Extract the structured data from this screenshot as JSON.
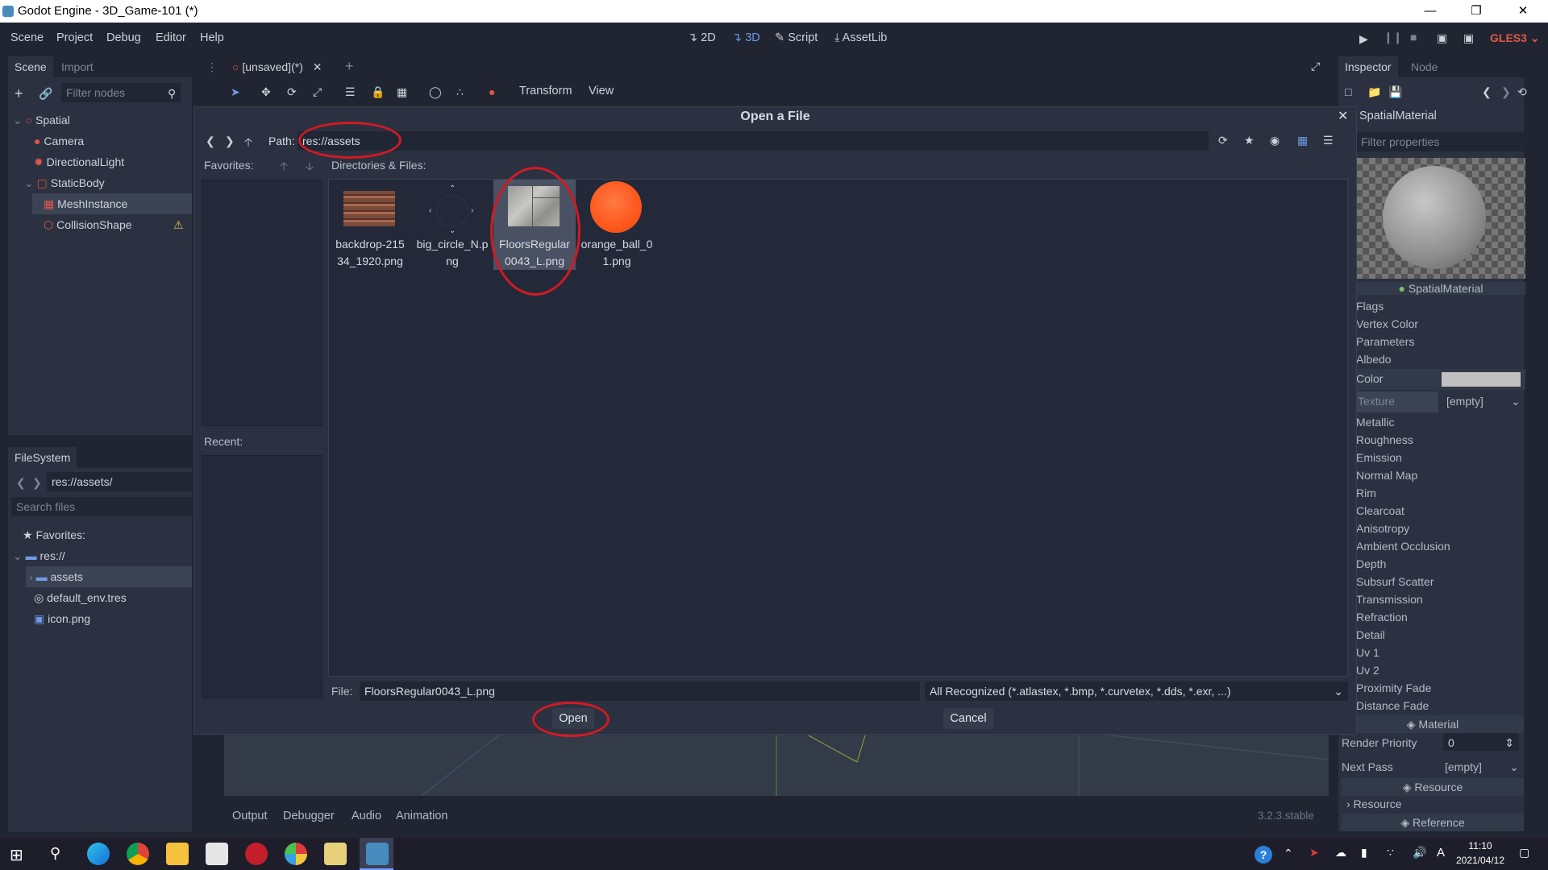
{
  "window": {
    "title": "Godot Engine - 3D_Game-101 (*)"
  },
  "menu": [
    "Scene",
    "Project",
    "Debug",
    "Editor",
    "Help"
  ],
  "workspaces": {
    "w2d": "2D",
    "w3d": "3D",
    "script": "Script",
    "assetlib": "AssetLib"
  },
  "renderer": "GLES3",
  "scene_dock": {
    "tabs": [
      "Scene",
      "Import"
    ],
    "filter_placeholder": "Filter nodes",
    "nodes": [
      "Spatial",
      "Camera",
      "DirectionalLight",
      "StaticBody",
      "MeshInstance",
      "CollisionShape"
    ]
  },
  "filesystem_dock": {
    "tab": "FileSystem",
    "path": "res://assets/",
    "search_placeholder": "Search files",
    "tree": [
      "Favorites:",
      "res://",
      "assets",
      "default_env.tres",
      "icon.png"
    ]
  },
  "editor_tabs": {
    "scene_tab": "[unsaved](*)"
  },
  "viewport_toolbar": {
    "transform": "Transform",
    "view": "View"
  },
  "bottom_panel": {
    "tabs": [
      "Output",
      "Debugger",
      "Audio",
      "Animation"
    ],
    "version": "3.2.3.stable"
  },
  "inspector": {
    "tabs": [
      "Inspector",
      "Node"
    ],
    "resource": "SpatialMaterial",
    "filter_placeholder": "Filter properties",
    "preview_caption": "SpatialMaterial",
    "sections": [
      "Flags",
      "Vertex Color",
      "Parameters",
      "Albedo"
    ],
    "albedo_color_label": "Color",
    "albedo_color_value": "#c0c0c0",
    "albedo_texture_label": "Texture",
    "albedo_texture_value": "[empty]",
    "more_sections": [
      "Metallic",
      "Roughness",
      "Emission",
      "Normal Map",
      "Rim",
      "Clearcoat",
      "Anisotropy",
      "Ambient Occlusion",
      "Depth",
      "Subsurf Scatter",
      "Transmission",
      "Refraction",
      "Detail",
      "Uv 1",
      "Uv 2",
      "Proximity Fade",
      "Distance Fade"
    ],
    "material_header": "Material",
    "render_priority_label": "Render Priority",
    "render_priority_value": "0",
    "next_pass_label": "Next Pass",
    "next_pass_value": "[empty]",
    "resource_header": "Resource",
    "resource_row": "Resource",
    "reference_header": "Reference"
  },
  "dialog": {
    "title": "Open a File",
    "path_label": "Path:",
    "path_value": "res://assets",
    "favorites_label": "Favorites:",
    "recent_label": "Recent:",
    "dirs_label": "Directories & Files:",
    "files": [
      {
        "name": "backdrop-21534_1920.png",
        "line1": "backdrop-215",
        "line2": "34_1920.png"
      },
      {
        "name": "big_circle_N.png",
        "line1": "big_circle_N.p",
        "line2": "ng"
      },
      {
        "name": "FloorsRegular0043_L.png",
        "line1": "FloorsRegular",
        "line2": "0043_L.png"
      },
      {
        "name": "orange_ball_01.png",
        "line1": "orange_ball_0",
        "line2": "1.png"
      }
    ],
    "file_label": "File:",
    "file_value": "FloorsRegular0043_L.png",
    "filter_value": "All Recognized (*.atlastex, *.bmp, *.curvetex, *.dds, *.exr, ...)",
    "open_button": "Open",
    "cancel_button": "Cancel"
  },
  "taskbar": {
    "time": "11:10",
    "date": "2021/04/12",
    "lang": "A"
  },
  "colors": {
    "accent": "#6f9ae6",
    "annotation": "#d21a24",
    "orange_ball": "#ff5a1f"
  }
}
